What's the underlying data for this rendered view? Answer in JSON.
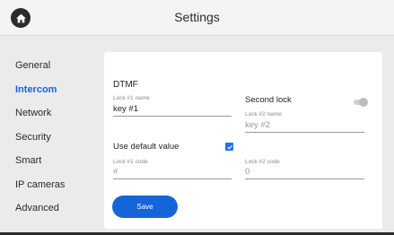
{
  "header": {
    "title": "Settings",
    "home_icon": "home-icon"
  },
  "sidebar": {
    "items": [
      {
        "label": "General",
        "active": false
      },
      {
        "label": "Intercom",
        "active": true
      },
      {
        "label": "Network",
        "active": false
      },
      {
        "label": "Security",
        "active": false
      },
      {
        "label": "Smart",
        "active": false
      },
      {
        "label": "IP cameras",
        "active": false
      },
      {
        "label": "Advanced",
        "active": false
      }
    ]
  },
  "panel": {
    "section_title": "DTMF",
    "lock1_name": {
      "label": "Lock #1 name",
      "value": "key #1"
    },
    "second_lock": {
      "label": "Second lock",
      "enabled": false
    },
    "lock2_name": {
      "label": "Lock #2 name",
      "placeholder": "key #2"
    },
    "use_default": {
      "label": "Use default value",
      "checked": true
    },
    "lock1_code": {
      "label": "Lock #1 code",
      "placeholder": "#"
    },
    "lock2_code": {
      "label": "Lock #2 code",
      "placeholder": "0"
    },
    "save_label": "Save"
  },
  "colors": {
    "accent": "#1565d8",
    "background": "#ebebeb",
    "panel": "#ffffff"
  }
}
